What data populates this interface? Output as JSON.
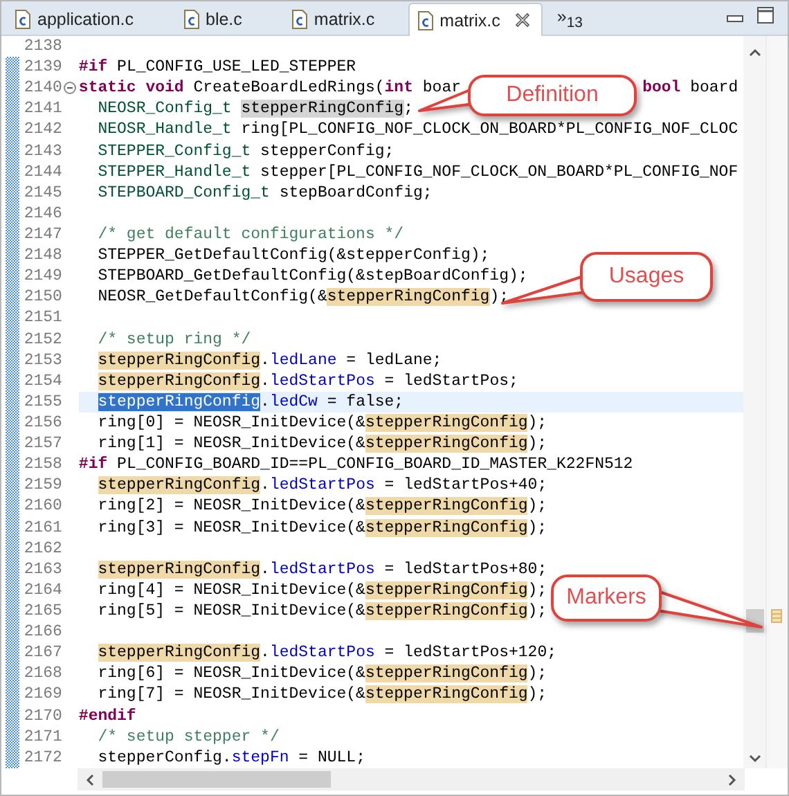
{
  "tabs": [
    {
      "label": "application.c",
      "selected": false,
      "closable": false
    },
    {
      "label": "ble.c",
      "selected": false,
      "closable": false
    },
    {
      "label": "matrix.c",
      "selected": false,
      "closable": false
    },
    {
      "label": "matrix.c",
      "selected": true,
      "closable": true
    }
  ],
  "overflow": "»$_{13}$",
  "lines": [
    {
      "number": "2138",
      "current": false
    },
    {
      "number": "2139",
      "current": false,
      "indent": false,
      "tokens": [
        {
          "kind": "kw",
          "text": "#if"
        },
        {
          "kind": "plain",
          "text": " PL_CONFIG_USE_LED_STEPPER"
        }
      ]
    },
    {
      "number": "2140",
      "current": false,
      "indent": false,
      "fold": {
        "expanded": true
      },
      "tokens": [
        {
          "kind": "kw",
          "text": "static void"
        },
        {
          "kind": "plain",
          "text": " CreateBoardLedRings("
        },
        {
          "kind": "kw",
          "text": "int"
        },
        {
          "kind": "plain",
          "text": " boar"
        }
      ],
      "tail": [
        {
          "kind": "kw",
          "text": "bool"
        },
        {
          "kind": "plain",
          "text": " board"
        }
      ]
    },
    {
      "number": "2141",
      "current": false,
      "indent": true,
      "tokens": [
        {
          "kind": "type",
          "text": "NEOSR_Config_t "
        },
        {
          "kind": "def",
          "text": "stepperRingConfig"
        },
        {
          "kind": "plain",
          "text": ";"
        }
      ]
    },
    {
      "number": "2142",
      "current": false,
      "indent": true,
      "tokens": [
        {
          "kind": "type",
          "text": "NEOSR_Handle_t"
        },
        {
          "kind": "plain",
          "text": " ring[PL_CONFIG_NOF_CLOCK_ON_BOARD*PL_CONFIG_NOF_CLOC"
        }
      ]
    },
    {
      "number": "2143",
      "current": false,
      "indent": true,
      "tokens": [
        {
          "kind": "type",
          "text": "STEPPER_Config_t"
        },
        {
          "kind": "plain",
          "text": " stepperConfig;"
        }
      ]
    },
    {
      "number": "2144",
      "current": false,
      "indent": true,
      "tokens": [
        {
          "kind": "type",
          "text": "STEPPER_Handle_t"
        },
        {
          "kind": "plain",
          "text": " stepper[PL_CONFIG_NOF_CLOCK_ON_BOARD*PL_CONFIG_NOF"
        }
      ]
    },
    {
      "number": "2145",
      "current": false,
      "indent": true,
      "tokens": [
        {
          "kind": "type",
          "text": "STEPBOARD_Config_t"
        },
        {
          "kind": "plain",
          "text": " stepBoardConfig;"
        }
      ]
    },
    {
      "number": "2146",
      "current": false
    },
    {
      "number": "2147",
      "current": false,
      "indent": true,
      "tokens": [
        {
          "kind": "comment",
          "text": "/* get default configurations */"
        }
      ]
    },
    {
      "number": "2148",
      "current": false,
      "indent": true,
      "tokens": [
        {
          "kind": "plain",
          "text": "STEPPER_GetDefaultConfig(&stepperConfig);"
        }
      ]
    },
    {
      "number": "2149",
      "current": false,
      "indent": true,
      "tokens": [
        {
          "kind": "plain",
          "text": "STEPBOARD_GetDefaultConfig(&stepBoardConfig);"
        }
      ]
    },
    {
      "number": "2150",
      "current": false,
      "indent": true,
      "tokens": [
        {
          "kind": "plain",
          "text": "NEOSR_GetDefaultConfig(&"
        },
        {
          "kind": "occ",
          "text": "stepperRingConfig"
        },
        {
          "kind": "plain",
          "text": ");"
        }
      ]
    },
    {
      "number": "2151",
      "current": false
    },
    {
      "number": "2152",
      "current": false,
      "indent": true,
      "tokens": [
        {
          "kind": "comment",
          "text": "/* setup ring */"
        }
      ]
    },
    {
      "number": "2153",
      "current": false,
      "indent": true,
      "tokens": [
        {
          "kind": "occ",
          "text": "stepperRingConfig"
        },
        {
          "kind": "plain",
          "text": "."
        },
        {
          "kind": "field",
          "text": "ledLane"
        },
        {
          "kind": "plain",
          "text": " = ledLane;"
        }
      ]
    },
    {
      "number": "2154",
      "current": false,
      "indent": true,
      "tokens": [
        {
          "kind": "occ",
          "text": "stepperRingConfig"
        },
        {
          "kind": "plain",
          "text": "."
        },
        {
          "kind": "field",
          "text": "ledStartPos"
        },
        {
          "kind": "plain",
          "text": " = ledStartPos;"
        }
      ]
    },
    {
      "number": "2155",
      "current": true,
      "indent": true,
      "tokens": [
        {
          "kind": "sel",
          "text": "stepperRingConfig"
        },
        {
          "kind": "plain",
          "text": "."
        },
        {
          "kind": "field",
          "text": "ledCw"
        },
        {
          "kind": "plain",
          "text": " = false;"
        }
      ]
    },
    {
      "number": "2156",
      "current": false,
      "indent": true,
      "tokens": [
        {
          "kind": "plain",
          "text": "ring[0] = NEOSR_InitDevice(&"
        },
        {
          "kind": "occ",
          "text": "stepperRingConfig"
        },
        {
          "kind": "plain",
          "text": ");"
        }
      ]
    },
    {
      "number": "2157",
      "current": false,
      "indent": true,
      "tokens": [
        {
          "kind": "plain",
          "text": "ring[1] = NEOSR_InitDevice(&"
        },
        {
          "kind": "occ",
          "text": "stepperRingConfig"
        },
        {
          "kind": "plain",
          "text": ");"
        }
      ]
    },
    {
      "number": "2158",
      "current": false,
      "indent": false,
      "tokens": [
        {
          "kind": "kw",
          "text": "#if"
        },
        {
          "kind": "plain",
          "text": " PL_CONFIG_BOARD_ID==PL_CONFIG_BOARD_ID_MASTER_K22FN512"
        }
      ]
    },
    {
      "number": "2159",
      "current": false,
      "indent": true,
      "tokens": [
        {
          "kind": "occ",
          "text": "stepperRingConfig"
        },
        {
          "kind": "plain",
          "text": "."
        },
        {
          "kind": "field",
          "text": "ledStartPos"
        },
        {
          "kind": "plain",
          "text": " = ledStartPos+40;"
        }
      ]
    },
    {
      "number": "2160",
      "current": false,
      "indent": true,
      "tokens": [
        {
          "kind": "plain",
          "text": "ring[2] = NEOSR_InitDevice(&"
        },
        {
          "kind": "occ",
          "text": "stepperRingConfig"
        },
        {
          "kind": "plain",
          "text": ");"
        }
      ]
    },
    {
      "number": "2161",
      "current": false,
      "indent": true,
      "tokens": [
        {
          "kind": "plain",
          "text": "ring[3] = NEOSR_InitDevice(&"
        },
        {
          "kind": "occ",
          "text": "stepperRingConfig"
        },
        {
          "kind": "plain",
          "text": ");"
        }
      ]
    },
    {
      "number": "2162",
      "current": false
    },
    {
      "number": "2163",
      "current": false,
      "indent": true,
      "tokens": [
        {
          "kind": "occ",
          "text": "stepperRingConfig"
        },
        {
          "kind": "plain",
          "text": "."
        },
        {
          "kind": "field",
          "text": "ledStartPos"
        },
        {
          "kind": "plain",
          "text": " = ledStartPos+80;"
        }
      ]
    },
    {
      "number": "2164",
      "current": false,
      "indent": true,
      "tokens": [
        {
          "kind": "plain",
          "text": "ring[4] = NEOSR_InitDevice(&"
        },
        {
          "kind": "occ",
          "text": "stepperRingConfig"
        },
        {
          "kind": "plain",
          "text": ");"
        }
      ]
    },
    {
      "number": "2165",
      "current": false,
      "indent": true,
      "tokens": [
        {
          "kind": "plain",
          "text": "ring[5] = NEOSR_InitDevice(&"
        },
        {
          "kind": "occ",
          "text": "stepperRingConfig"
        },
        {
          "kind": "plain",
          "text": ");"
        }
      ]
    },
    {
      "number": "2166",
      "current": false
    },
    {
      "number": "2167",
      "current": false,
      "indent": true,
      "tokens": [
        {
          "kind": "occ",
          "text": "stepperRingConfig"
        },
        {
          "kind": "plain",
          "text": "."
        },
        {
          "kind": "field",
          "text": "ledStartPos"
        },
        {
          "kind": "plain",
          "text": " = ledStartPos+120;"
        }
      ]
    },
    {
      "number": "2168",
      "current": false,
      "indent": true,
      "tokens": [
        {
          "kind": "plain",
          "text": "ring[6] = NEOSR_InitDevice(&"
        },
        {
          "kind": "occ",
          "text": "stepperRingConfig"
        },
        {
          "kind": "plain",
          "text": ");"
        }
      ]
    },
    {
      "number": "2169",
      "current": false,
      "indent": true,
      "tokens": [
        {
          "kind": "plain",
          "text": "ring[7] = NEOSR_InitDevice(&"
        },
        {
          "kind": "occ",
          "text": "stepperRingConfig"
        },
        {
          "kind": "plain",
          "text": ");"
        }
      ]
    },
    {
      "number": "2170",
      "current": false,
      "indent": false,
      "tokens": [
        {
          "kind": "kw",
          "text": "#endif"
        }
      ]
    },
    {
      "number": "2171",
      "current": false,
      "indent": true,
      "tokens": [
        {
          "kind": "comment",
          "text": "/* setup stepper */"
        }
      ]
    },
    {
      "number": "2172",
      "current": false,
      "indent": true,
      "tokens": [
        {
          "kind": "plain",
          "text": "stepperConfig."
        },
        {
          "kind": "field",
          "text": "stepFn"
        },
        {
          "kind": "plain",
          "text": " = NULL;"
        }
      ]
    }
  ],
  "callouts": [
    {
      "text": "Definition"
    },
    {
      "text": "Usages"
    },
    {
      "text": "Markers"
    }
  ]
}
